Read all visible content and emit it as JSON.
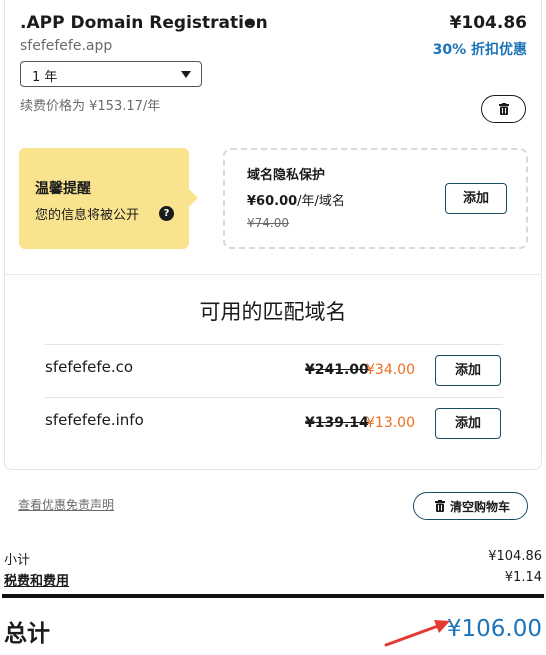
{
  "cart_item": {
    "title": ".APP Domain Registration",
    "price": "¥104.86",
    "domain": "sfefefefe.app",
    "discount": "30% 折扣优惠",
    "term": "1 年",
    "renewal": "续费价格为 ¥153.17/年"
  },
  "tip": {
    "title": "温馨提醒",
    "text": "您的信息将被公开"
  },
  "privacy": {
    "title": "域名隐私保护",
    "price": "¥60.00",
    "unit": "/年/域名",
    "old_price": "¥74.00",
    "add_label": "添加"
  },
  "available": {
    "title": "可用的匹配域名",
    "items": [
      {
        "name": "sfefefefe.co",
        "old_price": "¥241.00",
        "new_price": "¥34.00",
        "add_label": "添加"
      },
      {
        "name": "sfefefefe.info",
        "old_price": "¥139.14",
        "new_price": "¥13.00",
        "add_label": "添加"
      }
    ]
  },
  "footer": {
    "disclaimer": "查看优惠免责声明",
    "clear_cart": "清空购物车"
  },
  "summary": {
    "subtotal_label": "小计",
    "subtotal": "¥104.86",
    "tax_label": "税费和费用",
    "tax": "¥1.14",
    "total_label": "总计",
    "total": "¥106.00"
  },
  "colors": {
    "accent_blue": "#1d74b8",
    "sale_orange": "#ef6c1f",
    "tip_yellow": "#fae38f",
    "annotation_arrow": "#e53a2f"
  }
}
